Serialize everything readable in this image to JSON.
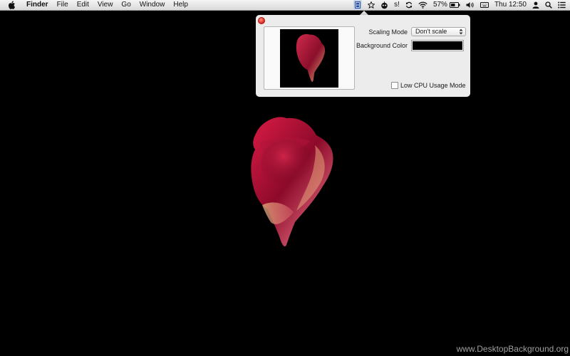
{
  "menubar": {
    "app_name": "Finder",
    "menus": [
      "File",
      "Edit",
      "View",
      "Go",
      "Window",
      "Help"
    ],
    "battery_percent": "57%",
    "clock": "Thu 12:50",
    "status_letter": "s!"
  },
  "popover": {
    "scaling_mode_label": "Scaling Mode",
    "scaling_mode_value": "Don't scale",
    "background_color_label": "Background Color",
    "background_color_value": "#000000",
    "low_cpu_label": "Low CPU Usage Mode",
    "low_cpu_checked": false
  },
  "desktop": {
    "watermark": "www.DesktopBackground.org"
  }
}
